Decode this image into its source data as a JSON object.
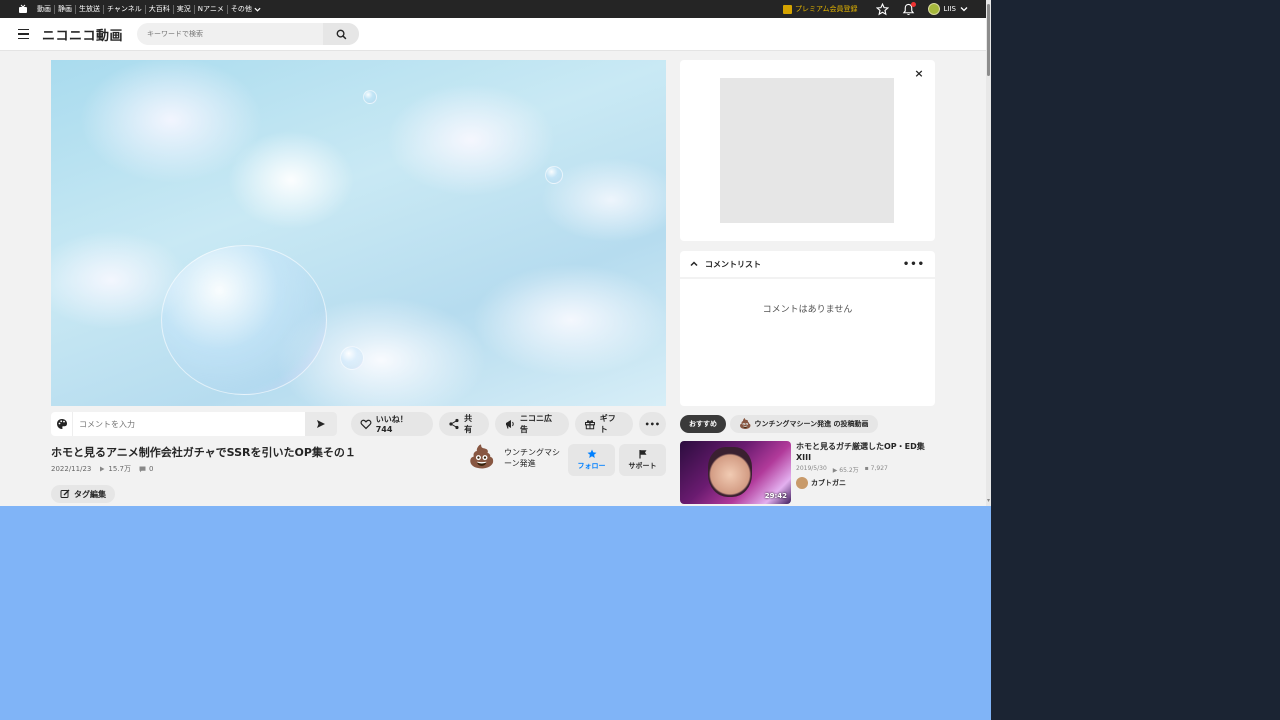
{
  "topbar": {
    "nav": [
      "動画",
      "静画",
      "生放送",
      "チャンネル",
      "大百科",
      "実況",
      "Nアニメ"
    ],
    "more_label": "その他",
    "premium_label": "プレミアム会員登録",
    "username": "LIIS"
  },
  "header": {
    "logo": "ニコニコ動画",
    "search_placeholder": "キーワードで検索"
  },
  "video": {
    "comment_placeholder": "コメントを入力",
    "like_label": "いいね！744",
    "share_label": "共有",
    "ad_label": "ニコニ広告",
    "gift_label": "ギフト",
    "more_label": "•••",
    "title": "ホモと見るアニメ制作会社ガチャでSSRを引いたOP集その１",
    "date": "2022/11/23",
    "views": "15.7万",
    "comments": "0",
    "tag_edit_label": "タグ編集"
  },
  "owner": {
    "avatar": "💩",
    "name": "ウンチングマシーン発進",
    "follow_label": "フォロー",
    "support_label": "サポート"
  },
  "sidebar": {
    "close_label": "×",
    "comment_list_title": "コメントリスト",
    "comment_list_more": "•••",
    "no_comments": "コメントはありません",
    "tabs": [
      {
        "label": "おすすめ"
      },
      {
        "label": "ウンチングマシーン発進 の投稿動画",
        "icon": "💩"
      }
    ],
    "recommendation": {
      "title": "ホモと見るガチ厳選したOP・ED集XIII",
      "date": "2019/5/30",
      "views": "65.2万",
      "comments": "7,927",
      "owner": "カブトガニ",
      "duration": "29:42"
    }
  }
}
